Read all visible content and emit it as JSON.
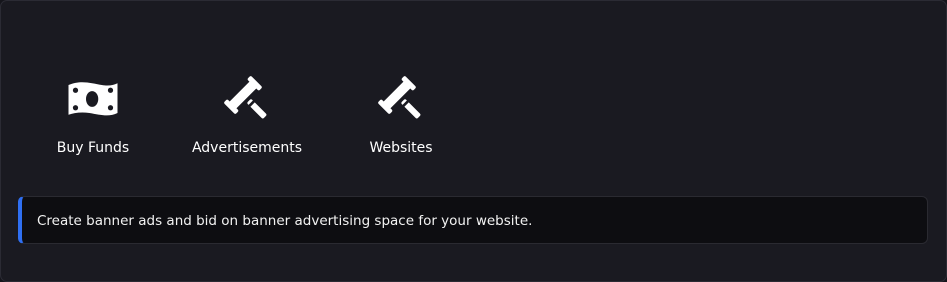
{
  "actions": [
    {
      "label": "Buy Funds",
      "icon": "banknote-icon"
    },
    {
      "label": "Advertisements",
      "icon": "gavel-icon"
    },
    {
      "label": "Websites",
      "icon": "gavel-icon"
    }
  ],
  "info": {
    "text": "Create banner ads and bid on banner advertising space for your website."
  },
  "colors": {
    "background": "#1a1a21",
    "info_background": "#0d0d11",
    "accent": "#2f6ff2",
    "text": "#ffffff"
  }
}
